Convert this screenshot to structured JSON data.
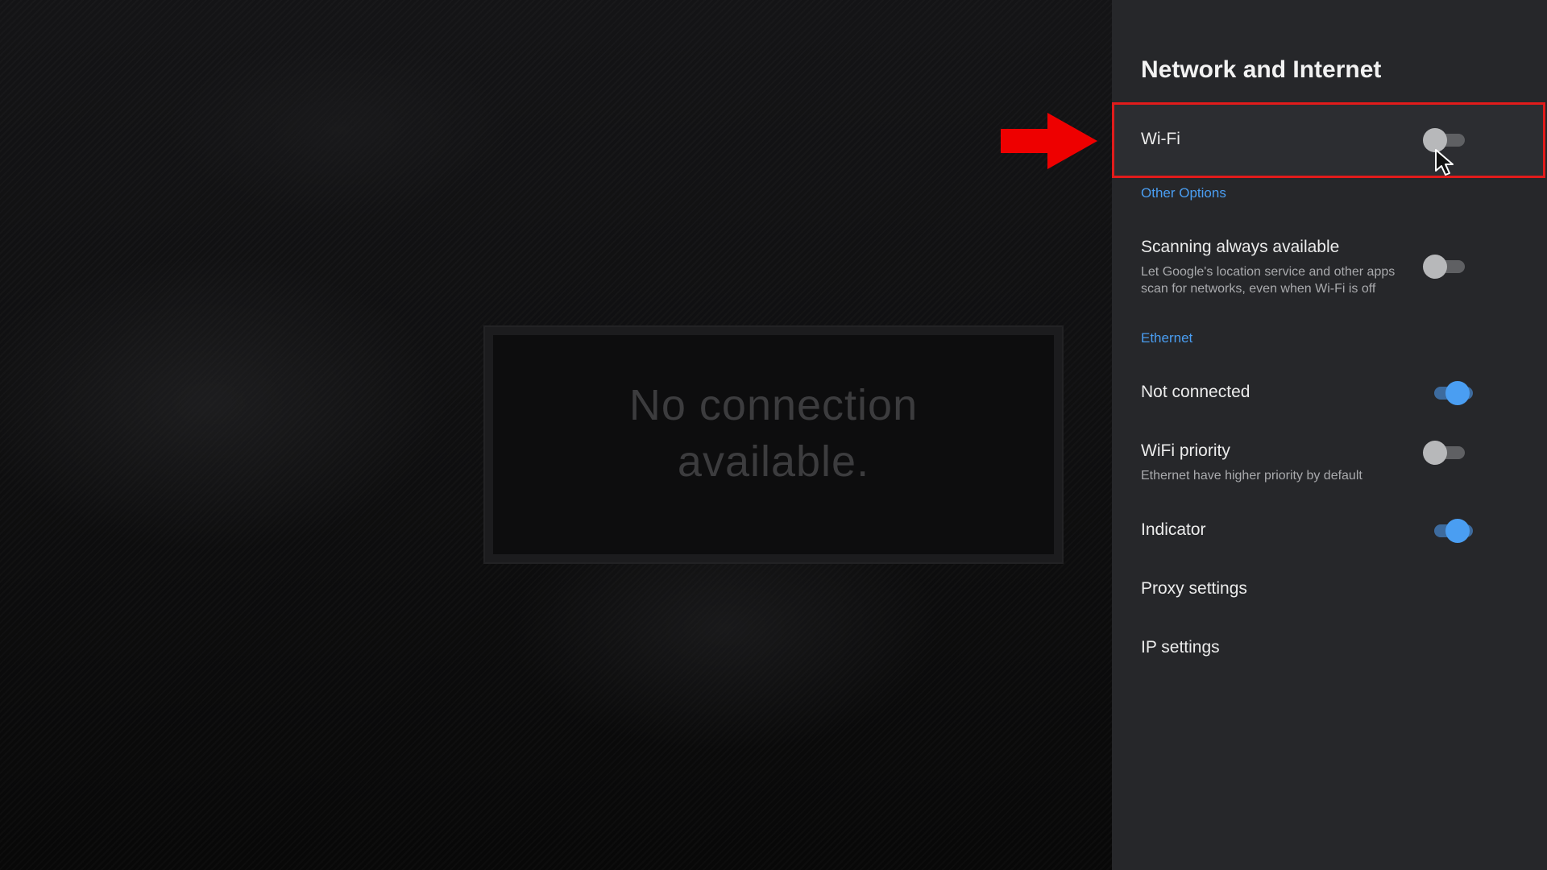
{
  "background": {
    "message": "No connection available."
  },
  "panel": {
    "title": "Network and Internet",
    "wifi": {
      "label": "Wi-Fi",
      "enabled": false
    },
    "sections": {
      "other_options": "Other Options",
      "ethernet": "Ethernet"
    },
    "scanning": {
      "label": "Scanning always available",
      "description": "Let Google's location service and other apps scan for networks, even when Wi-Fi is off",
      "enabled": false
    },
    "ethernet_status": {
      "label": "Not connected",
      "enabled": true
    },
    "wifi_priority": {
      "label": "WiFi priority",
      "description": "Ethernet have higher priority by default",
      "enabled": false
    },
    "indicator": {
      "label": "Indicator",
      "enabled": true
    },
    "proxy": {
      "label": "Proxy settings"
    },
    "ip": {
      "label": "IP settings"
    }
  },
  "colors": {
    "panel_bg": "#26272a",
    "accent": "#4a9ef2",
    "highlight": "#e21b1b"
  },
  "icons": {
    "annotation": "red-arrow-icon",
    "pointer": "mouse-cursor-icon"
  }
}
